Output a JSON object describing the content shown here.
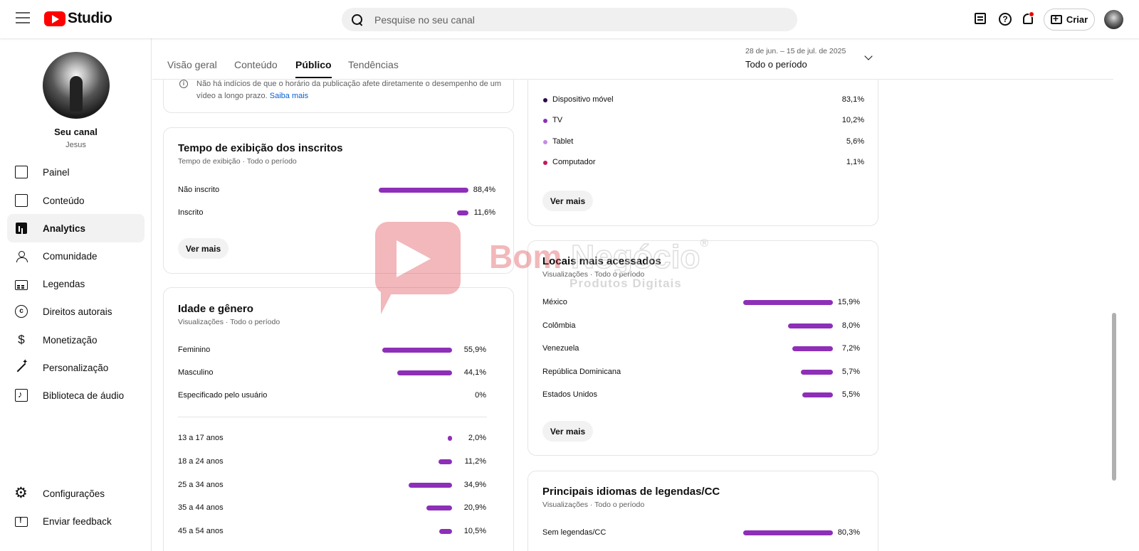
{
  "header": {
    "logo_text": "Studio",
    "search_placeholder": "Pesquise no seu canal",
    "create_label": "Criar"
  },
  "sidebar": {
    "channel_name": "Seu canal",
    "channel_handle": "Jesus",
    "items": [
      {
        "label": "Painel",
        "icon": "dashboard-icon"
      },
      {
        "label": "Conteúdo",
        "icon": "content-icon"
      },
      {
        "label": "Analytics",
        "icon": "analytics-icon",
        "active": true
      },
      {
        "label": "Comunidade",
        "icon": "community-icon"
      },
      {
        "label": "Legendas",
        "icon": "subtitles-icon"
      },
      {
        "label": "Direitos autorais",
        "icon": "copyright-icon"
      },
      {
        "label": "Monetização",
        "icon": "monetization-icon"
      },
      {
        "label": "Personalização",
        "icon": "customization-icon"
      },
      {
        "label": "Biblioteca de áudio",
        "icon": "audio-library-icon"
      }
    ],
    "bottom_items": [
      {
        "label": "Configurações",
        "icon": "settings-icon"
      },
      {
        "label": "Enviar feedback",
        "icon": "feedback-icon"
      }
    ]
  },
  "tabs": [
    "Visão geral",
    "Conteúdo",
    "Público",
    "Tendências"
  ],
  "active_tab": "Público",
  "date": {
    "range": "28 de jun. – 15 de jul. de 2025",
    "value": "Todo o período"
  },
  "publish_info": {
    "text": "Não há indícios de que o horário da publicação afete diretamente o desempenho de um vídeo a longo prazo.",
    "link": "Saiba mais"
  },
  "subscribers_card": {
    "title": "Tempo de exibição dos inscritos",
    "subtitle": "Tempo de exibição · Todo o período",
    "rows": [
      {
        "label": "Não inscrito",
        "value": "88,4%",
        "pct": 88.4
      },
      {
        "label": "Inscrito",
        "value": "11,6%",
        "pct": 11.6
      }
    ],
    "button": "Ver mais"
  },
  "age_gender_card": {
    "title": "Idade e gênero",
    "subtitle": "Visualizações · Todo o período",
    "gender_rows": [
      {
        "label": "Feminino",
        "value": "55,9%",
        "pct": 55.9
      },
      {
        "label": "Masculino",
        "value": "44,1%",
        "pct": 44.1
      },
      {
        "label": "Especificado pelo usuário",
        "value": "0%",
        "pct": 0
      }
    ],
    "age_rows": [
      {
        "label": "13 a 17 anos",
        "value": "2,0%",
        "pct": 2.0
      },
      {
        "label": "18 a 24 anos",
        "value": "11,2%",
        "pct": 11.2
      },
      {
        "label": "25 a 34 anos",
        "value": "34,9%",
        "pct": 34.9
      },
      {
        "label": "35 a 44 anos",
        "value": "20,9%",
        "pct": 20.9
      },
      {
        "label": "45 a 54 anos",
        "value": "10,5%",
        "pct": 10.5
      }
    ]
  },
  "device_card": {
    "rows": [
      {
        "label": "Dispositivo móvel",
        "value": "83,1%",
        "color": "#2a0a4a"
      },
      {
        "label": "TV",
        "value": "10,2%",
        "color": "#8e2fb8"
      },
      {
        "label": "Tablet",
        "value": "5,6%",
        "color": "#c58be6"
      },
      {
        "label": "Computador",
        "value": "1,1%",
        "color": "#c2185b"
      }
    ],
    "button": "Ver mais"
  },
  "locations_card": {
    "title": "Locais mais acessados",
    "subtitle": "Visualizações · Todo o período",
    "rows": [
      {
        "label": "México",
        "value": "15,9%",
        "pct": 15.9
      },
      {
        "label": "Colômbia",
        "value": "8,0%",
        "pct": 8.0
      },
      {
        "label": "Venezuela",
        "value": "7,2%",
        "pct": 7.2
      },
      {
        "label": "República Dominicana",
        "value": "5,7%",
        "pct": 5.7
      },
      {
        "label": "Estados Unidos",
        "value": "5,5%",
        "pct": 5.5
      }
    ],
    "button": "Ver mais"
  },
  "subtitles_card": {
    "title": "Principais idiomas de legendas/CC",
    "subtitle": "Visualizações · Todo o período",
    "rows": [
      {
        "label": "Sem legendas/CC",
        "value": "80,3%",
        "pct": 80.3
      }
    ]
  },
  "watermark": {
    "brand_part1": "Bom ",
    "brand_part2": "Negócio",
    "registered": "®",
    "tagline": "Produtos Digitais"
  },
  "colors": {
    "bar": "#8e2fb8",
    "brand_red": "#ff0000",
    "link": "#065fd4"
  }
}
